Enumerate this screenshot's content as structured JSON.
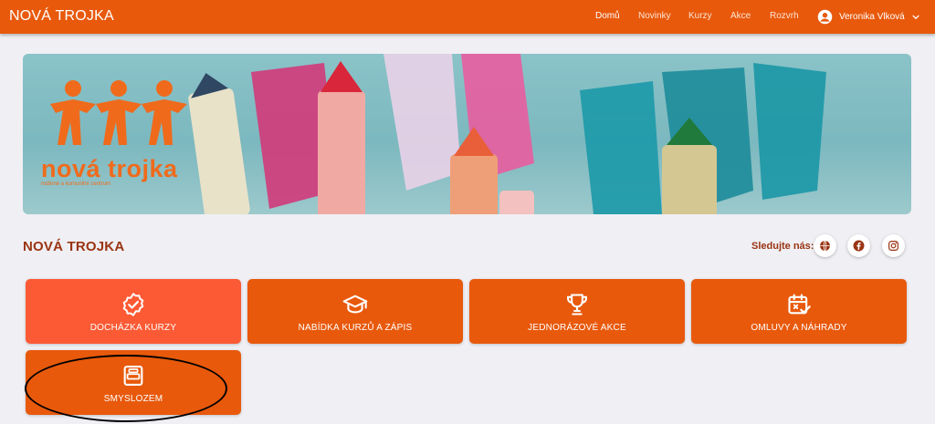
{
  "header": {
    "brand": "NOVÁ TROJKA",
    "nav": [
      {
        "label": "Domů",
        "active": true
      },
      {
        "label": "Novinky",
        "active": false
      },
      {
        "label": "Kurzy",
        "active": false
      },
      {
        "label": "Akce",
        "active": false
      },
      {
        "label": "Rozvrh",
        "active": false
      }
    ],
    "user": {
      "name": "Veronika Vlková",
      "icon": "account-circle-icon",
      "menu_icon": "chevron-down-icon"
    }
  },
  "banner": {
    "logo_text": "nová trojka",
    "logo_sub": "rodinné a komunitní centrum"
  },
  "page": {
    "title": "NOVÁ TROJKA",
    "follow_label": "Sledujte nás:",
    "social": [
      {
        "icon": "globe-icon"
      },
      {
        "icon": "facebook-icon"
      },
      {
        "icon": "instagram-icon"
      }
    ]
  },
  "tiles": [
    {
      "label": "DOCHÁZKA KURZY",
      "icon": "badge-check-icon"
    },
    {
      "label": "NABÍDKA KURZŮ A ZÁPIS",
      "icon": "graduation-cap-icon"
    },
    {
      "label": "JEDNORÁZOVÉ AKCE",
      "icon": "trophy-icon"
    },
    {
      "label": "OMLUVY A NÁHRADY",
      "icon": "calendar-check-icon"
    },
    {
      "label": "SMYSLOZEM",
      "icon": "bed-icon"
    }
  ],
  "colors": {
    "primary": "#e8590c",
    "tile_highlight": "#fb5a34",
    "title": "#9a3412",
    "background": "#f0eff4"
  }
}
